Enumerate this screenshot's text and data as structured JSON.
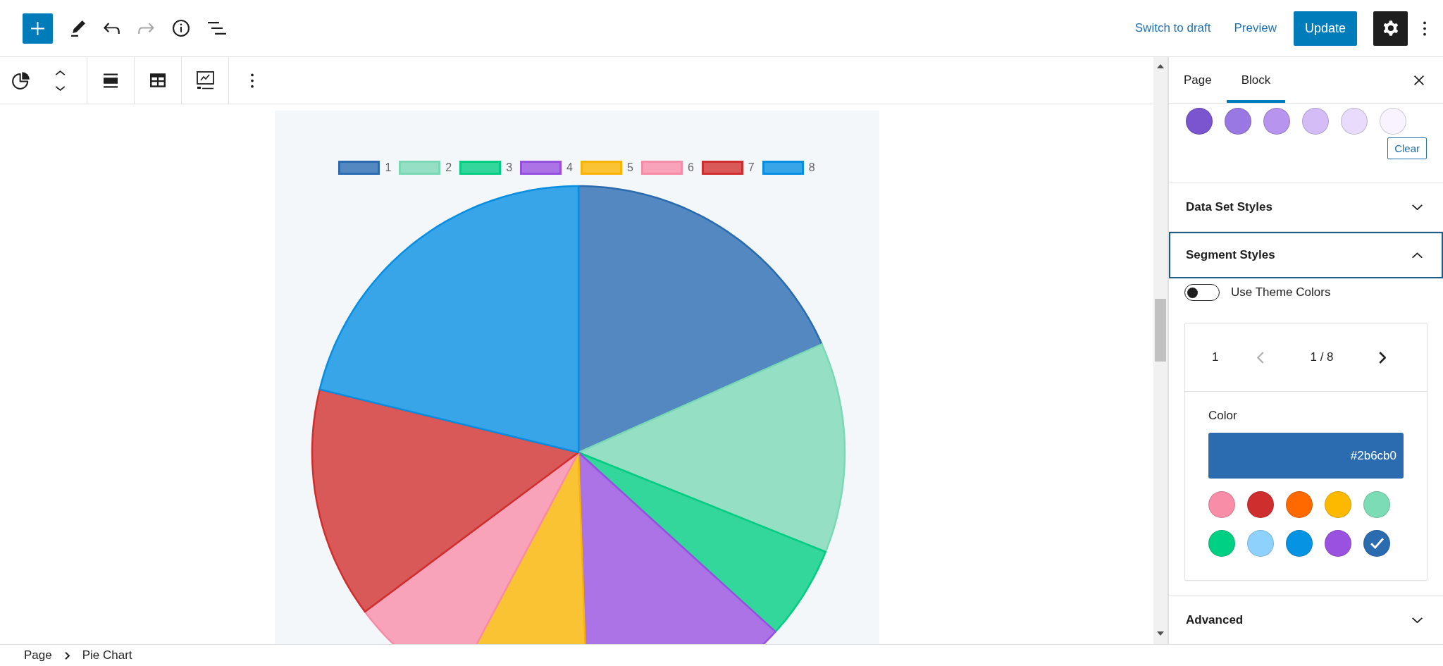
{
  "top_bar": {
    "undo": {
      "disabled": false
    },
    "redo": {
      "disabled": true
    },
    "actions": [
      {
        "label": "Switch to draft",
        "kind": "link"
      },
      {
        "label": "Preview",
        "kind": "link"
      },
      {
        "label": "Update",
        "kind": "primary"
      }
    ],
    "settings": {
      "pressed": true
    }
  },
  "chart": {
    "legend": [
      {
        "label": "1",
        "color": "#5488c0"
      },
      {
        "label": "2",
        "color": "#95e0c4"
      },
      {
        "label": "3",
        "color": "#33d69b"
      },
      {
        "label": "4",
        "color": "#ab73e6"
      },
      {
        "label": "5",
        "color": "#f9c333"
      },
      {
        "label": "6",
        "color": "#f8a3b9"
      },
      {
        "label": "7",
        "color": "#d95858"
      },
      {
        "label": "8",
        "color": "#38a5e8"
      }
    ]
  },
  "sidebar": {
    "tabs": [
      {
        "label": "Page",
        "selected": false
      },
      {
        "label": "Block",
        "selected": true
      }
    ],
    "top_section": {
      "swatches": [
        {
          "color": "#7b55cf"
        },
        {
          "color": "#9a78e3"
        },
        {
          "color": "#b795ee"
        },
        {
          "color": "#d4bdf7"
        },
        {
          "color": "#e8dbfb"
        },
        {
          "color": "#f8f3fe"
        }
      ],
      "clear_label": "Clear"
    },
    "panels": [
      {
        "title": "Data Set Styles",
        "expanded": false,
        "focused": false
      },
      {
        "title": "Segment Styles",
        "expanded": true,
        "focused": true,
        "content": {
          "toggle": {
            "label": "Use Theme Colors",
            "on": false
          },
          "segment": {
            "name": "1",
            "page": "1 / 8",
            "prev_disabled": true,
            "next_disabled": false
          },
          "color_label": "Color",
          "color_value": {
            "text": "#2b6cb0",
            "color": "#2b6cb0"
          },
          "palette": [
            {
              "color": "#f78da7",
              "selected": false
            },
            {
              "color": "#cf2e2e",
              "selected": false
            },
            {
              "color": "#ff6900",
              "selected": false
            },
            {
              "color": "#fcb900",
              "selected": false
            },
            {
              "color": "#7bdcb5",
              "selected": false
            },
            {
              "color": "#00d084",
              "selected": false
            },
            {
              "color": "#8ed1fc",
              "selected": false
            },
            {
              "color": "#0693e3",
              "selected": false
            },
            {
              "color": "#9b51e0",
              "selected": false
            },
            {
              "color": "#2b6cb0",
              "selected": true
            }
          ]
        }
      },
      {
        "title": "Advanced",
        "expanded": false,
        "focused": false
      }
    ]
  },
  "breadcrumb": [
    "Page",
    "Pie Chart"
  ]
}
